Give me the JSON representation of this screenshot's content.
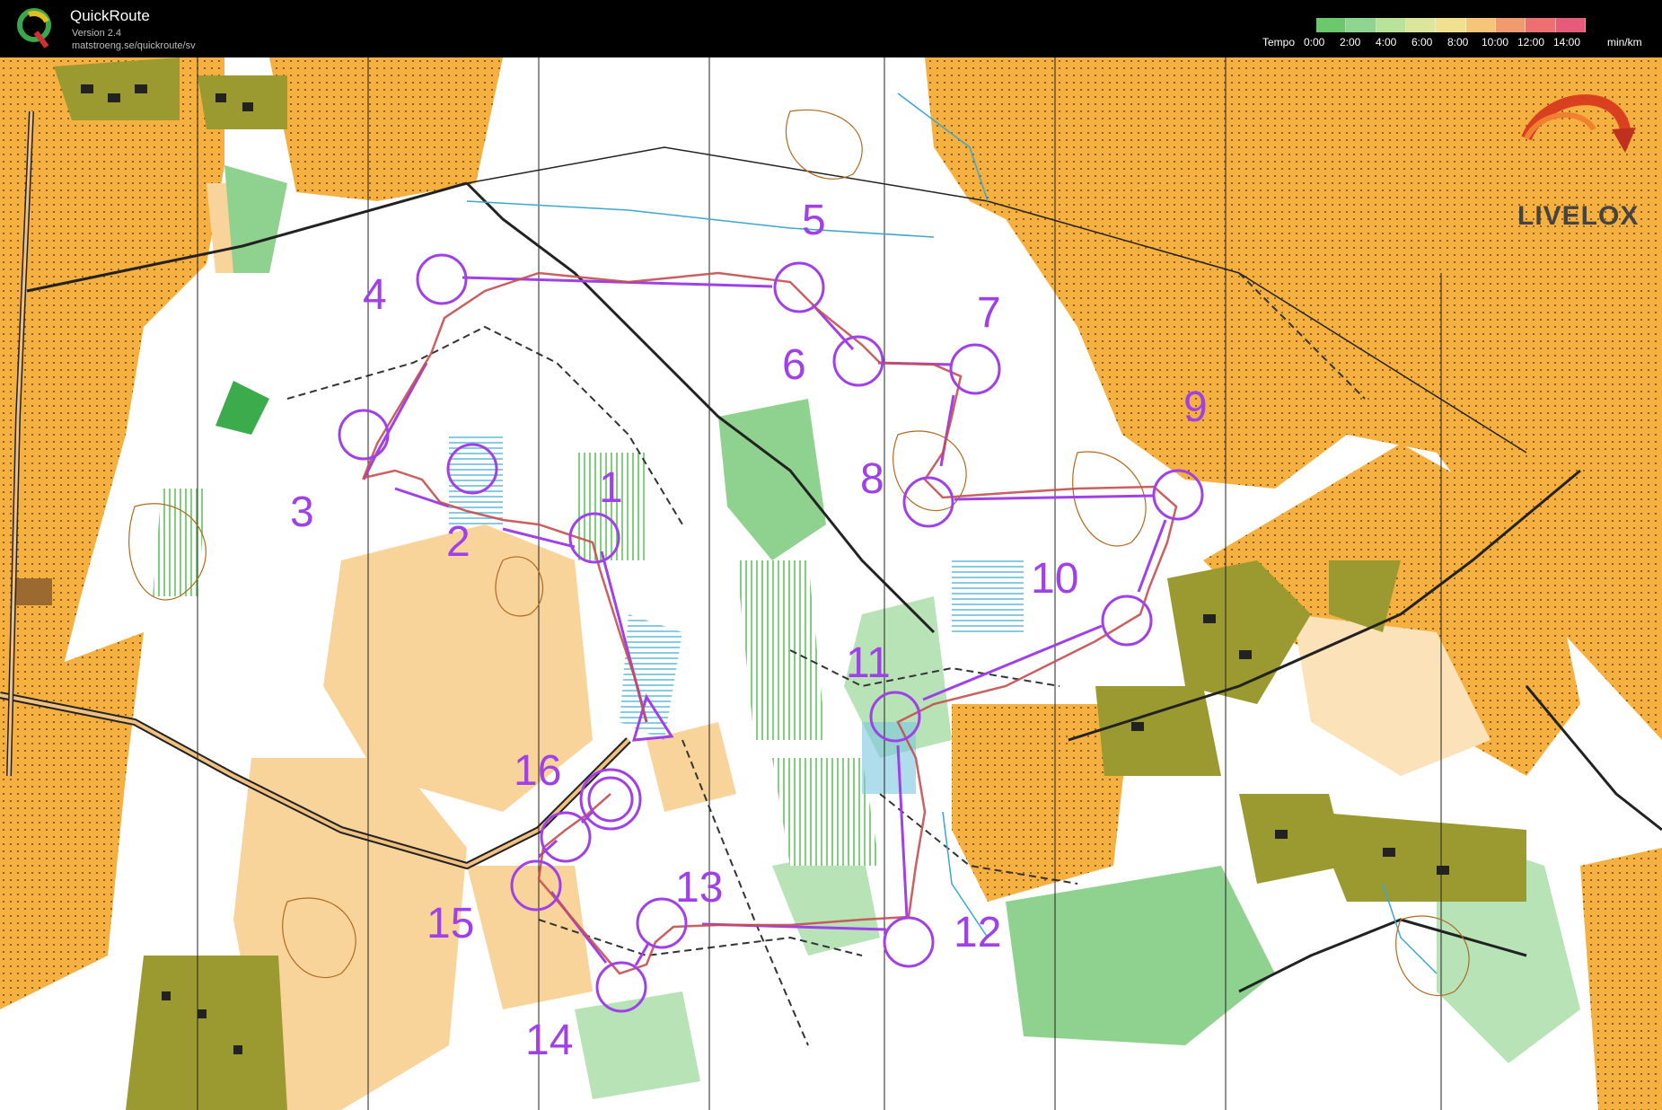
{
  "app": {
    "title": "QuickRoute",
    "version": "Version 2.4",
    "url": "matstroeng.se/quickroute/sv"
  },
  "tempo_legend": {
    "label": "Tempo",
    "ticks": [
      "0:00",
      "2:00",
      "4:00",
      "6:00",
      "8:00",
      "10:00",
      "12:00",
      "14:00"
    ],
    "unit": "min/km",
    "colors": [
      "#6cc86c",
      "#8fd48f",
      "#b9e29a",
      "#dbe69c",
      "#f0e08f",
      "#f5c67a",
      "#f29a6f",
      "#ee6f6f",
      "#e85a7a"
    ]
  },
  "watermark": {
    "brand": "LIVELOX"
  },
  "colors": {
    "course": "#a040e8",
    "open_land": "#f6b040",
    "semi_open": "#f9d49a",
    "forest_green": "#8fd28f",
    "dark_green": "#3cab4c",
    "buildings_olive": "#9a9a30",
    "water_blue": "#5fbcd8",
    "route": "#c45050"
  },
  "controls": [
    {
      "number": "1"
    },
    {
      "number": "2"
    },
    {
      "number": "3"
    },
    {
      "number": "4"
    },
    {
      "number": "5"
    },
    {
      "number": "6"
    },
    {
      "number": "7"
    },
    {
      "number": "8"
    },
    {
      "number": "9"
    },
    {
      "number": "10"
    },
    {
      "number": "11"
    },
    {
      "number": "12"
    },
    {
      "number": "13"
    },
    {
      "number": "14"
    },
    {
      "number": "15"
    },
    {
      "number": "16"
    }
  ]
}
